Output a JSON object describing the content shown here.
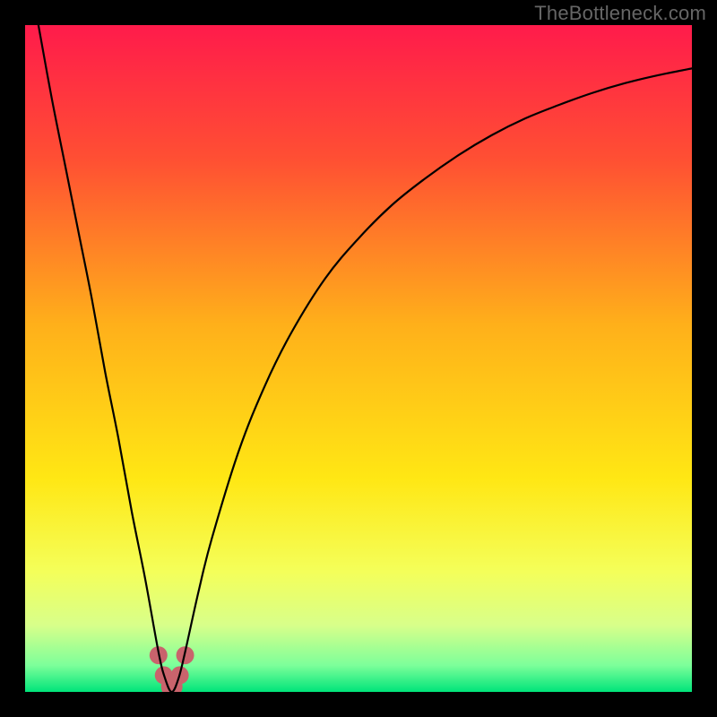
{
  "watermark": "TheBottleneck.com",
  "chart_data": {
    "type": "line",
    "title": "",
    "xlabel": "",
    "ylabel": "",
    "xlim": [
      0,
      100
    ],
    "ylim": [
      0,
      100
    ],
    "grid": false,
    "legend": false,
    "background_gradient_stops": [
      {
        "offset": 0.0,
        "color": "#ff1b4b"
      },
      {
        "offset": 0.2,
        "color": "#ff4f33"
      },
      {
        "offset": 0.45,
        "color": "#ffb01a"
      },
      {
        "offset": 0.68,
        "color": "#ffe714"
      },
      {
        "offset": 0.82,
        "color": "#f4ff5a"
      },
      {
        "offset": 0.9,
        "color": "#d8ff8a"
      },
      {
        "offset": 0.96,
        "color": "#7dff9a"
      },
      {
        "offset": 1.0,
        "color": "#00e47a"
      }
    ],
    "series": [
      {
        "name": "bottleneck-curve",
        "x": [
          2,
          4,
          6,
          8,
          10,
          12,
          14,
          16,
          18,
          20,
          21,
          22,
          23,
          24,
          26,
          28,
          32,
          36,
          40,
          45,
          50,
          55,
          60,
          65,
          70,
          75,
          80,
          85,
          90,
          95,
          100
        ],
        "y": [
          100,
          89,
          79,
          69,
          59,
          48,
          38,
          27,
          17,
          6,
          2,
          0,
          2,
          6,
          15,
          23,
          36,
          46,
          54,
          62,
          68,
          73,
          77,
          80.5,
          83.5,
          86,
          88,
          89.8,
          91.3,
          92.5,
          93.5
        ]
      }
    ],
    "markers": {
      "name": "min-region",
      "color": "#c9636c",
      "points": [
        {
          "x": 20.0,
          "y": 5.5,
          "r": 10
        },
        {
          "x": 20.8,
          "y": 2.5,
          "r": 10
        },
        {
          "x": 22.0,
          "y": 0.8,
          "r": 12
        },
        {
          "x": 23.2,
          "y": 2.5,
          "r": 10
        },
        {
          "x": 24.0,
          "y": 5.5,
          "r": 10
        }
      ]
    }
  }
}
